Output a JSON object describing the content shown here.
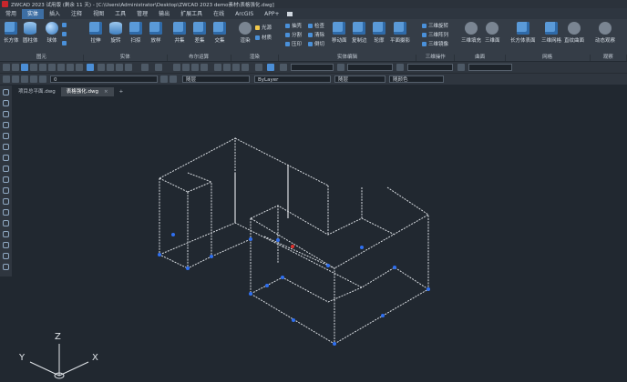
{
  "window": {
    "title": "ZWCAD 2023 试用版 (剩余 11 天) - [C:\\Users\\Administrator\\Desktop\\ZWCAD 2023 demo素材\\表格强化.dwg]"
  },
  "menu_tabs": [
    "常用",
    "实体",
    "插入",
    "注释",
    "视图",
    "工具",
    "管理",
    "输出",
    "扩展工具",
    "在线",
    "ArcGIS",
    "APP+"
  ],
  "active_tab": "实体",
  "ribbon": {
    "primitives": [
      "长方体",
      "圆柱体",
      "球体"
    ],
    "solids": [
      "拉伸",
      "旋转",
      "扫掠",
      "放样"
    ],
    "boolean": [
      "并集",
      "差集",
      "交集"
    ],
    "render": [
      "渲染",
      "光源",
      "材质"
    ],
    "edit_small": [
      "抽壳",
      "分割",
      "压印",
      "检查",
      "清除",
      "倒切"
    ],
    "edit_large": [
      "移动面",
      "复制边",
      "轮廓",
      "平面摄影"
    ],
    "ops_small": [
      "三维旋转",
      "三维阵列",
      "三维镜像"
    ],
    "section": [
      "三维填充",
      "三维面"
    ],
    "mesh": [
      "长方体表面",
      "三维网格",
      "直纹曲面"
    ],
    "view": [
      "动态观察"
    ]
  },
  "groups": [
    "图元",
    "实体",
    "布尔运算",
    "渲染",
    "实体编辑",
    "三维操作",
    "曲面",
    "网格",
    "观察"
  ],
  "layer_bar": {
    "layer": "0",
    "layer2": "随层",
    "linetype": "ByLayer",
    "lineweight": "随层",
    "color": "随颜色"
  },
  "doc_tabs": [
    {
      "name": "项目总平面",
      "ext": ".dwg",
      "active": false
    },
    {
      "name": "表格强化",
      "ext": ".dwg",
      "active": true
    }
  ],
  "ucs": {
    "x": "X",
    "y": "Y",
    "z": "Z"
  },
  "colors": {
    "background": "#212830",
    "accent": "#3d6ea3",
    "grip": "#2f6ff0",
    "wire": "#d9dde2"
  }
}
